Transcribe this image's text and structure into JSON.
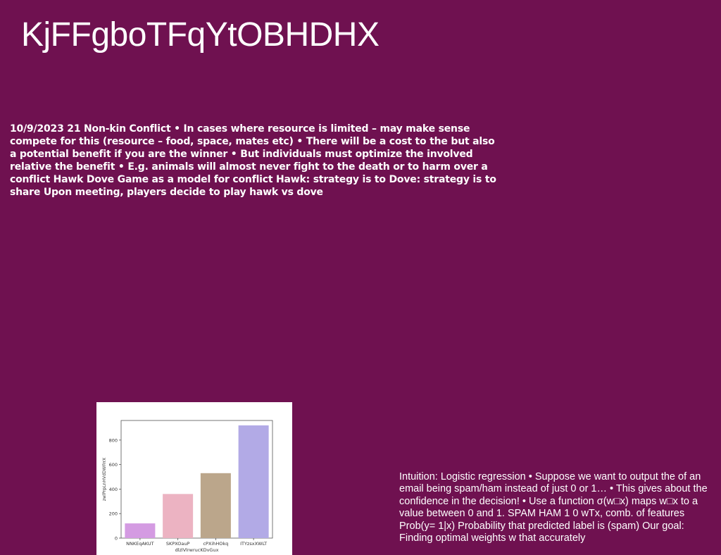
{
  "slide": {
    "title": "KjFFgboTFqYtOBHDHX",
    "body_text": "10/9/2023 21 Non-kin Conflict • In cases where resource is limited – may make sense compete for this (resource – food, space, mates etc) • There will be a cost to the but also a potential benefit if you are the winner • But individuals must optimize the involved relative the benefit • E.g. animals will almost never fight to the death or to harm over a conflict Hawk Dove Game as a model for conflict Hawk: strategy is to Dove: strategy is to share Upon meeting, players decide to play hawk vs dove",
    "side_text": "Intuition: Logistic regression • Suppose we want to output the of an email being spam/ham instead of just 0 or 1… • This gives about the confidence in the decision! • Use a function σ(w□x) maps w□x to a value between 0 and 1. SPAM HAM 1 0 wTx, comb. of features Prob(y= 1|x) Probability that predicted label is (spam) Our goal: Finding optimal weights w that accurately"
  },
  "colors": {
    "background": "#6f1150",
    "text": "#ffffff"
  },
  "chart_data": {
    "type": "bar",
    "categories": [
      "NNKEqAKUT",
      "SKPXOauP",
      "cPXihHOkq",
      "ITYzsxXWLT"
    ],
    "values": [
      120,
      360,
      530,
      920
    ],
    "bar_colors": [
      "#d49be2",
      "#ecb3c2",
      "#bba68b",
      "#b2aae6"
    ],
    "xlabel": "dlzlVlrwrucKDvGux",
    "ylabel": "zwlPrpLnHVdDWFrrX",
    "ylim": [
      0,
      960
    ],
    "yticks": [
      0,
      200,
      400,
      600,
      800
    ],
    "grid": false
  }
}
